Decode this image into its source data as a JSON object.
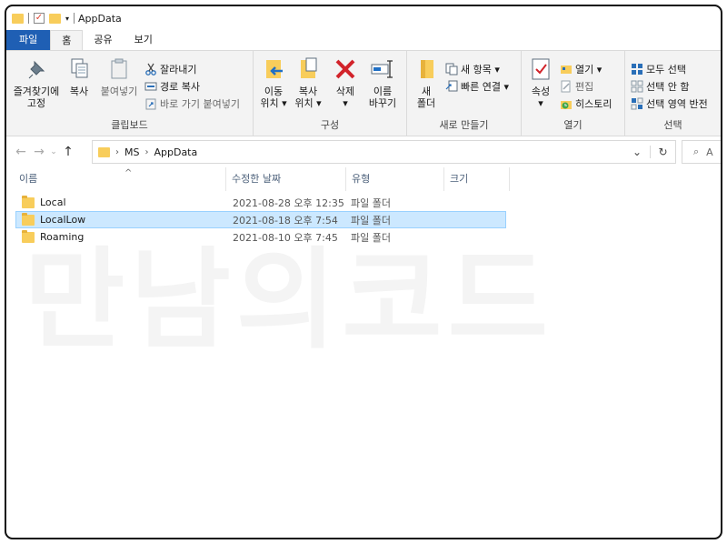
{
  "window": {
    "title": "AppData"
  },
  "tabs": {
    "file": "파일",
    "home": "홈",
    "share": "공유",
    "view": "보기"
  },
  "ribbon": {
    "clipboard": {
      "label": "클립보드",
      "pin": "즐겨찾기에\n고정",
      "copy": "복사",
      "paste": "붙여넣기",
      "cut": "잘라내기",
      "copy_path": "경로 복사",
      "paste_shortcut": "바로 가기 붙여넣기"
    },
    "organize": {
      "label": "구성",
      "move_to": "이동\n위치 ▾",
      "copy_to": "복사\n위치 ▾",
      "delete": "삭제\n▾",
      "rename": "이름\n바꾸기"
    },
    "new": {
      "label": "새로 만들기",
      "new_folder": "새\n폴더",
      "new_item": "새 항목 ▾",
      "easy_access": "빠른 연결 ▾"
    },
    "open": {
      "label": "열기",
      "properties": "속성\n▾",
      "open": "열기 ▾",
      "edit": "편집",
      "history": "히스토리"
    },
    "select": {
      "label": "선택",
      "select_all": "모두 선택",
      "select_none": "선택 안 함",
      "invert": "선택 영역 반전"
    }
  },
  "address": {
    "path": [
      "MS",
      "AppData"
    ],
    "search_placeholder": "A"
  },
  "columns": {
    "name": "이름",
    "date": "수정한 날짜",
    "type": "유형",
    "size": "크기"
  },
  "files": [
    {
      "name": "Local",
      "date": "2021-08-28 오후 12:35",
      "type": "파일 폴더",
      "selected": false
    },
    {
      "name": "LocalLow",
      "date": "2021-08-18 오후 7:54",
      "type": "파일 폴더",
      "selected": true
    },
    {
      "name": "Roaming",
      "date": "2021-08-10 오후 7:45",
      "type": "파일 폴더",
      "selected": false
    }
  ],
  "watermark": "만남의코드",
  "colors": {
    "file_tab": "#1f5fb4",
    "selection": "#cce8ff",
    "folder": "#f8cd5b"
  }
}
